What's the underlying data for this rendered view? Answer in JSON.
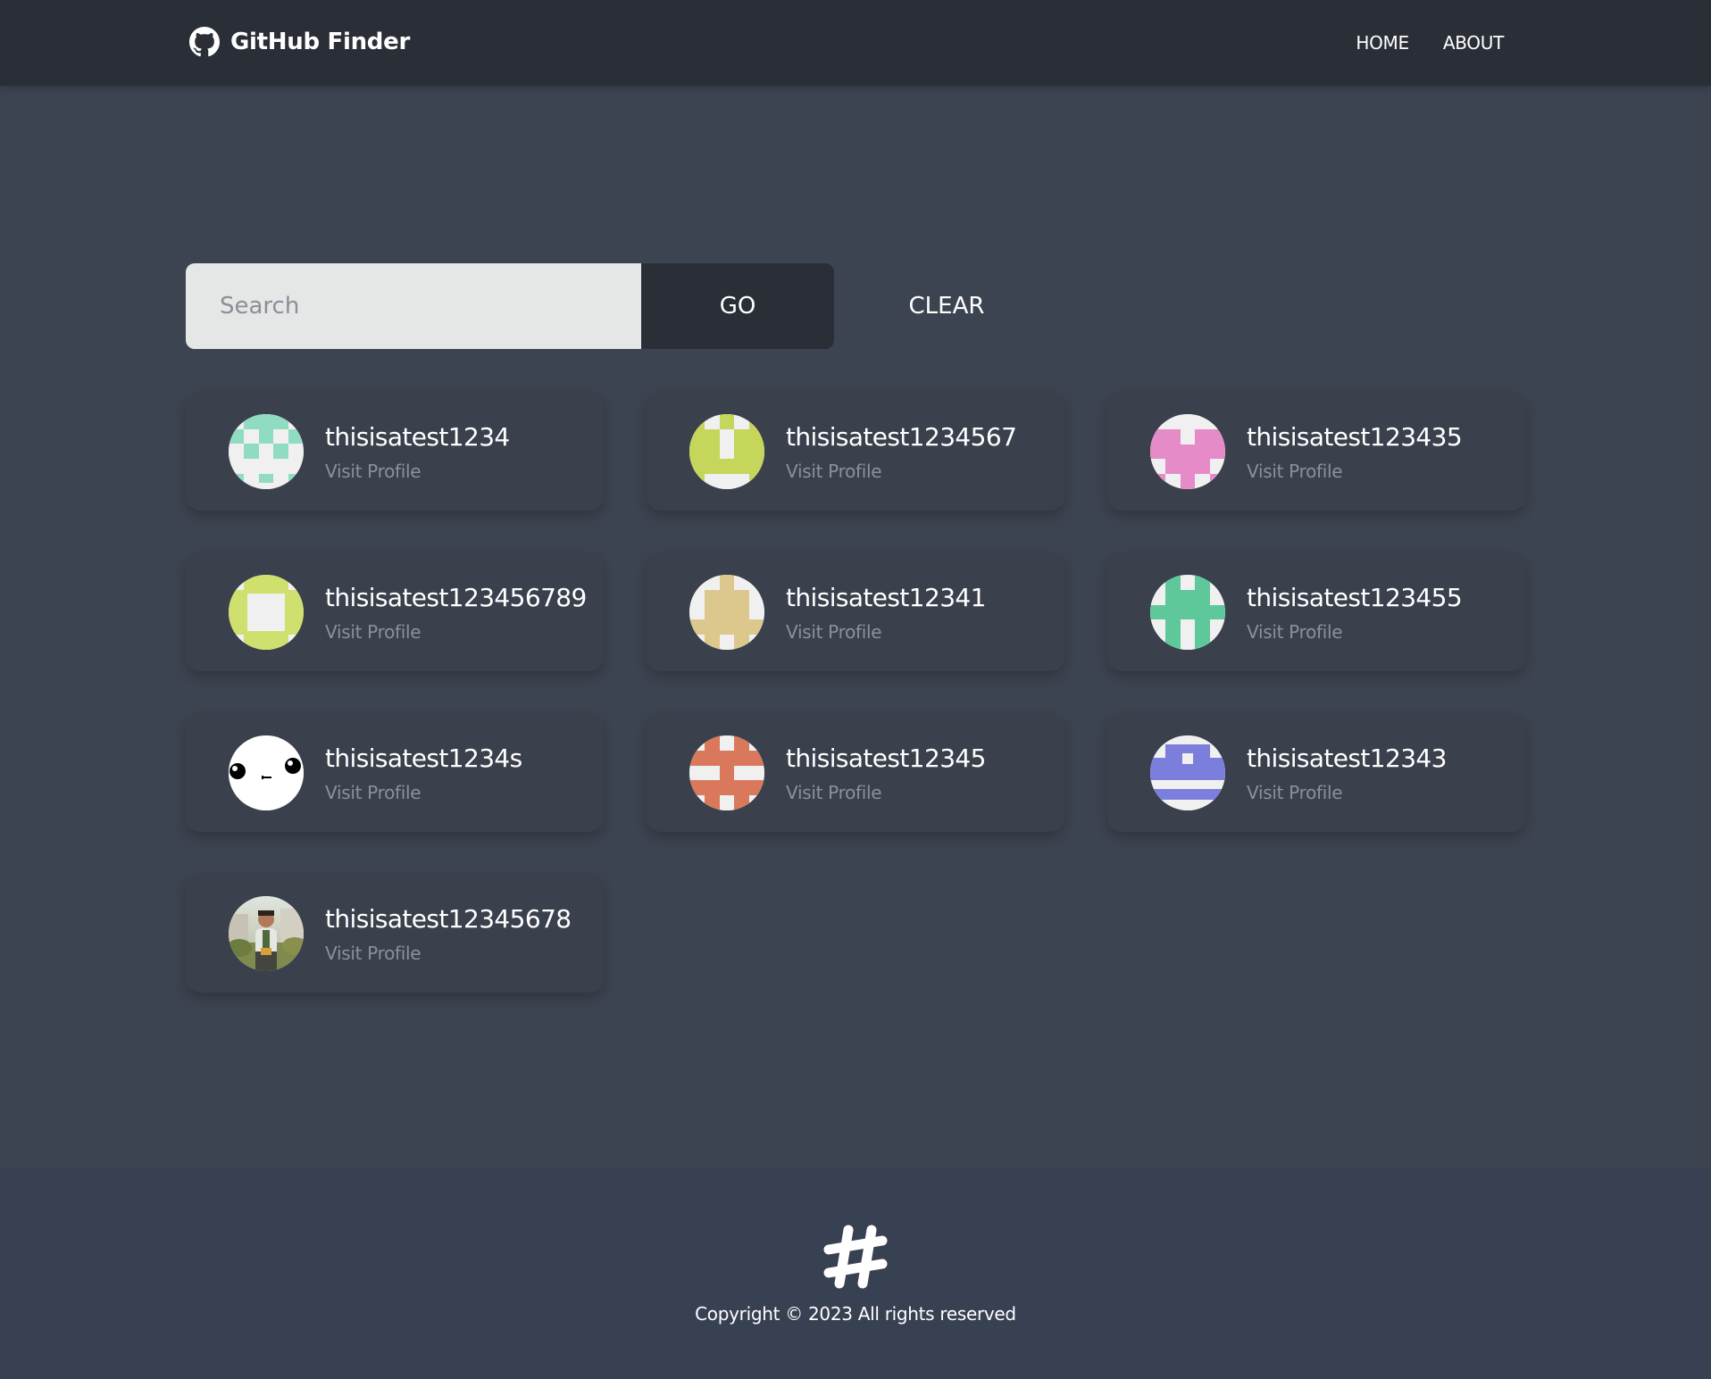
{
  "navbar": {
    "brand_title": "GitHub Finder",
    "brand_icon": "github-icon",
    "links": [
      "HOME",
      "ABOUT"
    ]
  },
  "search": {
    "placeholder": "Search",
    "value": "",
    "go_label": "GO",
    "clear_label": "CLEAR"
  },
  "users": [
    {
      "login": "thisisatest1234",
      "link_label": "Visit Profile",
      "avatar": {
        "type": "identicon",
        "color": "#8fdcc2"
      }
    },
    {
      "login": "thisisatest1234567",
      "link_label": "Visit Profile",
      "avatar": {
        "type": "identicon",
        "color": "#c5d65a"
      }
    },
    {
      "login": "thisisatest123435",
      "link_label": "Visit Profile",
      "avatar": {
        "type": "identicon",
        "color": "#e58bc7"
      }
    },
    {
      "login": "thisisatest123456789",
      "link_label": "Visit Profile",
      "avatar": {
        "type": "identicon",
        "color": "#cfe06f"
      }
    },
    {
      "login": "thisisatest12341",
      "link_label": "Visit Profile",
      "avatar": {
        "type": "identicon",
        "color": "#dcc88d"
      }
    },
    {
      "login": "thisisatest123455",
      "link_label": "Visit Profile",
      "avatar": {
        "type": "identicon",
        "color": "#5fc89a"
      }
    },
    {
      "login": "thisisatest1234s",
      "link_label": "Visit Profile",
      "avatar": {
        "type": "face-icon",
        "color": "#ffffff"
      }
    },
    {
      "login": "thisisatest12345",
      "link_label": "Visit Profile",
      "avatar": {
        "type": "identicon",
        "color": "#d9785b"
      }
    },
    {
      "login": "thisisatest12343",
      "link_label": "Visit Profile",
      "avatar": {
        "type": "identicon",
        "color": "#7b7fdb"
      }
    },
    {
      "login": "thisisatest12345678",
      "link_label": "Visit Profile",
      "avatar": {
        "type": "photo",
        "color": "#a9b36a"
      }
    }
  ],
  "footer": {
    "logo_icon": "hashtag-logo-icon",
    "copyright": "Copyright © 2023 All rights reserved"
  },
  "colors": {
    "navbar_bg": "#2a2e37",
    "page_bg": "#3d4451",
    "card_bg": "#3a404c",
    "footer_bg": "#384152"
  }
}
